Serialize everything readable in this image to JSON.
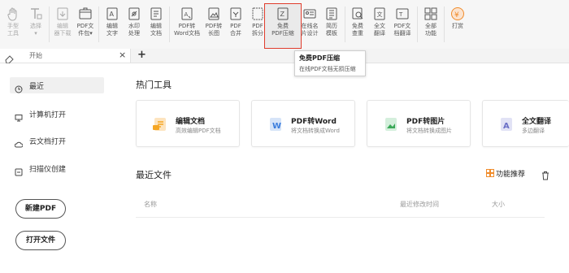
{
  "toolbar": {
    "items": [
      {
        "label1": "手型",
        "label2": "工具",
        "icon": "hand-icon",
        "disabled": true
      },
      {
        "label1": "选择",
        "label2": "▾",
        "icon": "text-select-icon",
        "disabled": true
      },
      {
        "label1": "编辑",
        "label2": "器下载",
        "icon": "edit-download-icon",
        "disabled": true
      },
      {
        "label1": "PDF文",
        "label2": "件包▾",
        "icon": "pdf-package-icon",
        "disabled": false
      },
      {
        "label1": "编辑",
        "label2": "文字",
        "icon": "edit-text-icon",
        "disabled": false
      },
      {
        "label1": "水印",
        "label2": "处理",
        "icon": "watermark-icon",
        "disabled": false
      },
      {
        "label1": "编辑",
        "label2": "文档",
        "icon": "edit-doc-icon",
        "disabled": false
      },
      {
        "label1": "PDF转",
        "label2": "Word文档",
        "icon": "pdf-to-word-icon",
        "disabled": false
      },
      {
        "label1": "PDF转",
        "label2": "长图",
        "icon": "pdf-to-image-icon",
        "disabled": false
      },
      {
        "label1": "PDF",
        "label2": "合并",
        "icon": "pdf-merge-icon",
        "disabled": false
      },
      {
        "label1": "PDF",
        "label2": "拆分",
        "icon": "pdf-split-icon",
        "disabled": false
      },
      {
        "label1": "免费",
        "label2": "PDF压缩",
        "icon": "pdf-compress-icon",
        "disabled": false
      },
      {
        "label1": "在线名",
        "label2": "片设计",
        "icon": "card-design-icon",
        "disabled": false
      },
      {
        "label1": "简历",
        "label2": "模板",
        "icon": "resume-template-icon",
        "disabled": false
      },
      {
        "label1": "免费",
        "label2": "查重",
        "icon": "plagiarism-check-icon",
        "disabled": false
      },
      {
        "label1": "全文",
        "label2": "翻译",
        "icon": "full-translate-icon",
        "disabled": false
      },
      {
        "label1": "PDF文",
        "label2": "档翻译",
        "icon": "pdf-translate-icon",
        "disabled": false
      },
      {
        "label1": "全部",
        "label2": "功能",
        "icon": "all-features-icon",
        "disabled": false
      },
      {
        "label1": "打赏",
        "label2": "",
        "icon": "reward-icon",
        "disabled": false
      }
    ]
  },
  "tabs": {
    "current": "开始",
    "close": "×",
    "add": "+"
  },
  "tooltip": {
    "title": "免费PDF压缩",
    "desc": "在线PDF文档无损压缩"
  },
  "sidebar": {
    "items": [
      {
        "label": "最近",
        "icon": "clock-icon"
      },
      {
        "label": "计算机打开",
        "icon": "computer-icon"
      },
      {
        "label": "云文档打开",
        "icon": "cloud-icon"
      },
      {
        "label": "扫描仪创建",
        "icon": "scanner-icon"
      }
    ],
    "new_pdf": "新建PDF",
    "open_file": "打开文件"
  },
  "main": {
    "hot_tools_title": "热门工具",
    "cards": [
      {
        "title": "编辑文档",
        "desc": "高效编辑PDF文档",
        "icon": "edit-doc-icon",
        "color": "#f5a623"
      },
      {
        "title": "PDF转Word",
        "desc": "将文档转换成Word",
        "icon": "word-icon",
        "color": "#3b7ddd"
      },
      {
        "title": "PDF转图片",
        "desc": "将文档转换成图片",
        "icon": "image-icon",
        "color": "#3aa858"
      },
      {
        "title": "全文翻译",
        "desc": "多边翻译",
        "icon": "translate-icon",
        "color": "#6a6fc6"
      }
    ],
    "recent_title": "最近文件",
    "feature_recommend": "功能推荐",
    "columns": {
      "name": "名称",
      "modified": "最近修改时间",
      "size": "大小"
    }
  },
  "colors": {
    "highlight_border": "#e03c2c",
    "reward": "#f08b2a"
  }
}
